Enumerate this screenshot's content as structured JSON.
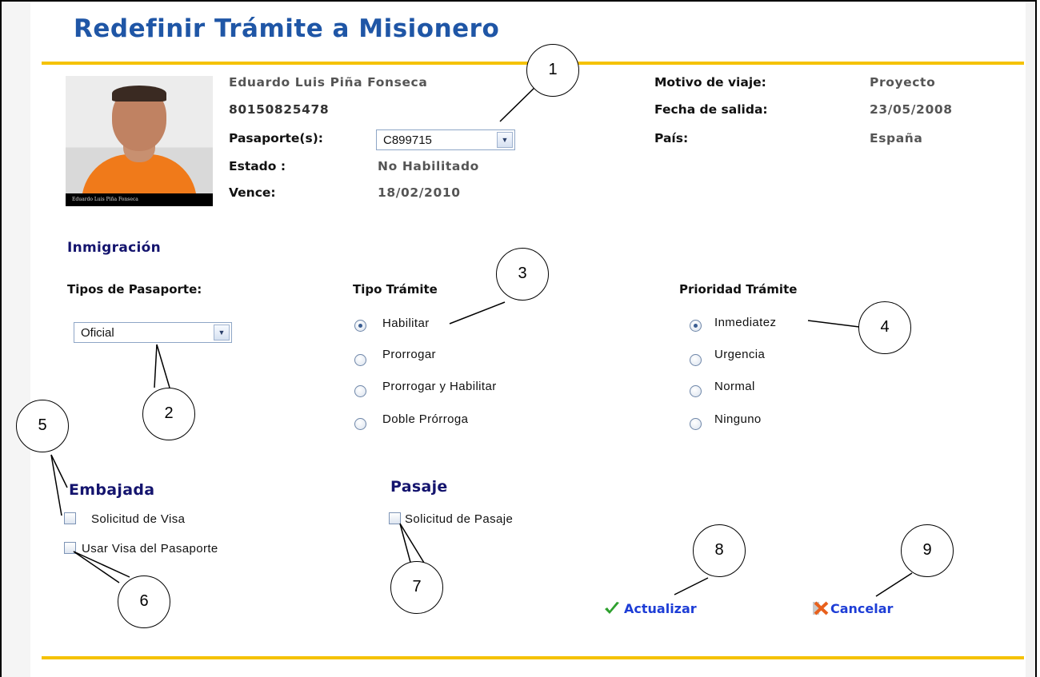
{
  "title": "Redefinir Trámite a Misionero",
  "person": {
    "photo_caption": "Eduardo Luis Piña Fonseca",
    "name": "Eduardo Luis Piña Fonseca",
    "id_number": "80150825478",
    "passport_label": "Pasaporte(s):",
    "passport_value": "C899715",
    "status_label": "Estado :",
    "status_value": "No Habilitado",
    "expires_label": "Vence:",
    "expires_value": "18/02/2010"
  },
  "trip": {
    "reason_label": "Motivo de viaje:",
    "reason_value": "Proyecto",
    "departure_label": "Fecha de salida:",
    "departure_value": "23/05/2008",
    "country_label": "País:",
    "country_value": "España"
  },
  "immigration": {
    "heading": "Inmigración",
    "passport_types_label": "Tipos de Pasaporte:",
    "passport_type_value": "Oficial",
    "procedure_type_label": "Tipo Trámite",
    "procedure_types": [
      "Habilitar",
      "Prorrogar",
      "Prorrogar y Habilitar",
      "Doble Prórroga"
    ],
    "procedure_selected": "Habilitar",
    "priority_label": "Prioridad Trámite",
    "priorities": [
      "Inmediatez",
      "Urgencia",
      "Normal",
      "Ninguno"
    ],
    "priority_selected": "Inmediatez"
  },
  "embassy": {
    "heading": "Embajada",
    "visa_request": "Solicitud de Visa",
    "use_passport_visa": "Usar Visa del Pasaporte"
  },
  "ticket": {
    "heading": "Pasaje",
    "ticket_request": "Solicitud de Pasaje"
  },
  "actions": {
    "update": "Actualizar",
    "cancel": "Cancelar"
  },
  "callouts": [
    "1",
    "2",
    "3",
    "4",
    "5",
    "6",
    "7",
    "8",
    "9"
  ],
  "colors": {
    "title": "#1f56a6",
    "divider": "#f5c200",
    "section_heading": "#14146e",
    "link": "#1d3dd6",
    "check_icon": "#2ea02e",
    "cancel_icon": "#e8601c"
  },
  "icons": {
    "update": "check-icon",
    "cancel": "cancel-icon",
    "dropdown": "chevron-down-icon"
  }
}
